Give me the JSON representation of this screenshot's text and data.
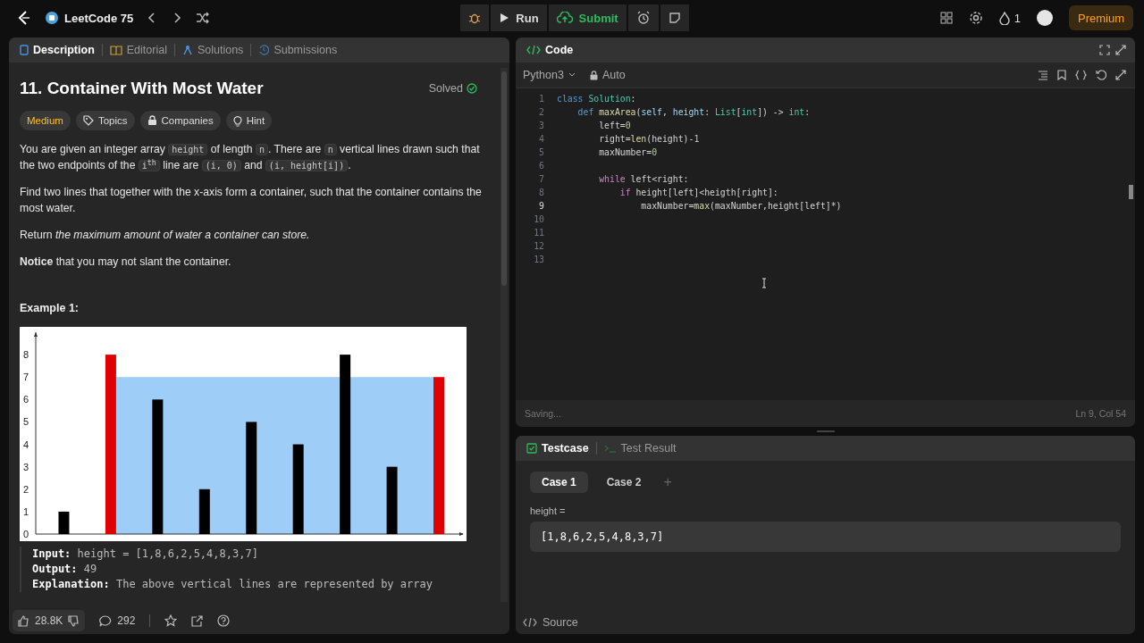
{
  "topbar": {
    "title": "LeetCode 75",
    "run": "Run",
    "submit": "Submit",
    "streak": "1",
    "premium": "Premium"
  },
  "problem_tabs": [
    {
      "label": "Description",
      "kind": "description",
      "selected": true
    },
    {
      "label": "Editorial",
      "kind": "editorial",
      "selected": false
    },
    {
      "label": "Solutions",
      "kind": "solutions",
      "selected": false
    },
    {
      "label": "Submissions",
      "kind": "submissions",
      "selected": false
    }
  ],
  "problem": {
    "title": "11. Container With Most Water",
    "status": "Solved",
    "difficulty": "Medium",
    "tags": [
      {
        "label": "Topics",
        "kind": "tag"
      },
      {
        "label": "Companies",
        "kind": "lock"
      },
      {
        "label": "Hint",
        "kind": "bulb"
      }
    ],
    "paragraphs": [
      [
        {
          "kind": "text",
          "text": "You are given an integer array "
        },
        {
          "kind": "code",
          "text": "height"
        },
        {
          "kind": "text",
          "text": " of length "
        },
        {
          "kind": "code",
          "text": "n"
        },
        {
          "kind": "text",
          "text": ". There are "
        },
        {
          "kind": "code",
          "text": "n"
        },
        {
          "kind": "text",
          "text": " vertical lines drawn such that the two endpoints of the "
        },
        {
          "kind": "code",
          "text": "i$^{th}$"
        },
        {
          "kind": "text",
          "text": " line are "
        },
        {
          "kind": "code",
          "text": "(i, 0)"
        },
        {
          "kind": "text",
          "text": " and "
        },
        {
          "kind": "code",
          "text": "(i, height[i])"
        },
        {
          "kind": "text",
          "text": "."
        }
      ],
      [
        {
          "kind": "text",
          "text": "Find two lines that together with the x-axis form a container, such that the container contains the most water."
        }
      ],
      [
        {
          "kind": "text",
          "text": "Return *the maximum amount of water a container can store.*"
        }
      ],
      [
        {
          "kind": "text",
          "text": "**Notice** that you may not slant the container."
        }
      ]
    ],
    "example_title": "Example 1:",
    "chart_data": {
      "type": "bar",
      "ylim": [
        0,
        9
      ],
      "yticks": [
        0,
        1,
        2,
        3,
        4,
        5,
        6,
        7,
        8
      ],
      "series": [
        {
          "color": "#000000",
          "values": [
            1,
            null,
            6,
            2,
            5,
            4,
            8,
            3,
            null
          ]
        },
        {
          "color": "#e00000",
          "values": [
            null,
            8,
            null,
            null,
            null,
            null,
            null,
            null,
            7
          ]
        }
      ]
    },
    "example_lines": [
      "**Input:** height = [1,8,6,2,5,4,8,3,7]",
      "**Output:** 49",
      "**Explanation:** The above vertical lines are represented by array"
    ]
  },
  "footer": {
    "likes": "28.8K",
    "comments": "292"
  },
  "editor": {
    "title": "Code",
    "language": "Python3",
    "mode": "Auto",
    "status": "Saving...",
    "cursor": "Ln 9, Col 54",
    "lines": [
      {
        "number": "1",
        "current": false,
        "tokens": [
          {
            "kind": "kw",
            "text": "class"
          },
          {
            "kind": "cls",
            "text": " Solution"
          },
          {
            "kind": "plain",
            "text": ":"
          }
        ]
      },
      {
        "number": "2",
        "current": false,
        "tokens": [
          {
            "kind": "kw",
            "text": "    def"
          },
          {
            "kind": "fn",
            "text": " maxArea"
          },
          {
            "kind": "plain",
            "text": "("
          },
          {
            "kind": "param",
            "text": "self"
          },
          {
            "kind": "plain",
            "text": ", "
          },
          {
            "kind": "param",
            "text": "height"
          },
          {
            "kind": "plain",
            "text": ": "
          },
          {
            "kind": "cls",
            "text": "List"
          },
          {
            "kind": "plain",
            "text": "["
          },
          {
            "kind": "cls",
            "text": "int"
          },
          {
            "kind": "plain",
            "text": "]) -> "
          },
          {
            "kind": "cls",
            "text": "int"
          },
          {
            "kind": "plain",
            "text": ":"
          }
        ]
      },
      {
        "number": "3",
        "current": false,
        "tokens": [
          {
            "kind": "plain",
            "text": "        left="
          },
          {
            "kind": "num",
            "text": "0"
          }
        ]
      },
      {
        "number": "4",
        "current": false,
        "tokens": [
          {
            "kind": "plain",
            "text": "        right="
          },
          {
            "kind": "fn",
            "text": "len"
          },
          {
            "kind": "plain",
            "text": "(height)-"
          },
          {
            "kind": "num",
            "text": "1"
          }
        ]
      },
      {
        "number": "5",
        "current": false,
        "tokens": [
          {
            "kind": "plain",
            "text": "        maxNumber="
          },
          {
            "kind": "num",
            "text": "0"
          }
        ]
      },
      {
        "number": "6",
        "current": false
      },
      {
        "number": "7",
        "current": false,
        "tokens": [
          {
            "kind": "ctl",
            "text": "        while"
          },
          {
            "kind": "plain",
            "text": " left<right:"
          }
        ]
      },
      {
        "number": "8",
        "current": false,
        "tokens": [
          {
            "kind": "ctl",
            "text": "            if"
          },
          {
            "kind": "plain",
            "text": " height[left]<heigth[right]:"
          }
        ]
      },
      {
        "number": "9",
        "current": true,
        "tokens": [
          {
            "kind": "plain",
            "text": "                maxNumber="
          },
          {
            "kind": "fn",
            "text": "max"
          },
          {
            "kind": "plain",
            "text": "(maxNumber,height[left]*)"
          }
        ]
      },
      {
        "number": "10",
        "current": false
      },
      {
        "number": "11",
        "current": false
      },
      {
        "number": "12",
        "current": false
      },
      {
        "number": "13",
        "current": false
      }
    ]
  },
  "test_tabs": [
    {
      "label": "Testcase",
      "kind": "testcase",
      "selected": true
    },
    {
      "label": "Test Result",
      "kind": "result",
      "selected": false
    }
  ],
  "cases": [
    {
      "label": "Case 1",
      "selected": true
    },
    {
      "label": "Case 2",
      "selected": false
    }
  ],
  "add_case": "+",
  "param_label": "height =",
  "param_value": "[1,8,6,2,5,4,8,3,7]",
  "source": "Source"
}
